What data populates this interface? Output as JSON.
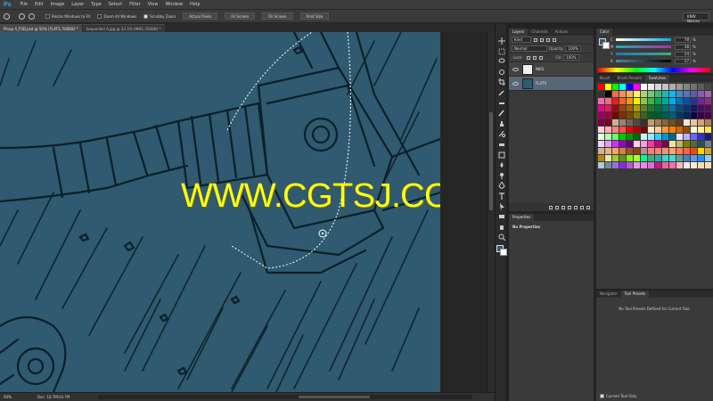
{
  "app": {
    "logo": "Ps"
  },
  "menu": [
    "File",
    "Edit",
    "Image",
    "Layer",
    "Type",
    "Select",
    "Filter",
    "View",
    "Window",
    "Help"
  ],
  "options": {
    "resize_windows": "Resize Windows to Fit",
    "zoom_all_windows": "Zoom All Windows",
    "scrubby_zoom": "Scrubby Zoom",
    "actual_pixels": "Actual Pixels",
    "fit_screen": "Fit Screen",
    "fill_screen": "Fill Screen",
    "print_size": "Print Size",
    "workspace": "KNW Nasrav"
  },
  "tabs": [
    {
      "label": "Pinup A_FSD.psd @ 50% (FLATS, RGB/8) *",
      "active": true
    },
    {
      "label": "Sequential A.jpg @ 33.3% (INKS, RGB/8) *",
      "active": false
    }
  ],
  "canvas": {
    "watermark": "WWW.CGTSJ.COM",
    "fill_color": "#2f5a70",
    "ink_color": "#0d1f2a"
  },
  "status": {
    "zoom": "50%",
    "doc": "Doc: 10.7M/10.7M"
  },
  "layers": {
    "tabs": [
      "Layers",
      "Channels",
      "Actions"
    ],
    "kind": "Kind",
    "blend_mode": "Normal",
    "opacity_label": "Opacity:",
    "opacity": "100%",
    "lock_label": "Lock:",
    "fill_label": "Fill:",
    "fill": "100%",
    "items": [
      {
        "name": "INKS",
        "selected": false
      },
      {
        "name": "FLATS",
        "selected": true
      }
    ]
  },
  "properties": {
    "tab": "Properties",
    "message": "No Properties"
  },
  "color": {
    "tab": "Color",
    "sliders": [
      {
        "label": "C",
        "value": "78",
        "unit": "%"
      },
      {
        "label": "M",
        "value": "38",
        "unit": "%"
      },
      {
        "label": "Y",
        "value": "24",
        "unit": "%"
      },
      {
        "label": "K",
        "value": "27",
        "unit": "%"
      }
    ],
    "foreground": "#2f5a70",
    "background": "#ffffff"
  },
  "swatches_panel": {
    "tabs": [
      "Brush",
      "Brush Presets",
      "Swatches"
    ],
    "colors": [
      "#ff0000",
      "#ffff00",
      "#00ff00",
      "#00ffff",
      "#0000ff",
      "#ff00ff",
      "#ffffff",
      "#ebebeb",
      "#d6d6d6",
      "#c2c2c2",
      "#adadad",
      "#999999",
      "#858585",
      "#707070",
      "#5c5c5c",
      "#474747",
      "#333333",
      "#000000",
      "#f26c4f",
      "#f68e55",
      "#fbaf5c",
      "#fff467",
      "#acd372",
      "#7cc576",
      "#3bb878",
      "#1abbb4",
      "#00bff3",
      "#438ccb",
      "#5574b9",
      "#605ca8",
      "#855fa8",
      "#a763a8",
      "#f06ea9",
      "#f26d7d",
      "#ed1c24",
      "#f26522",
      "#f7941d",
      "#fff200",
      "#8dc63f",
      "#39b54a",
      "#00a651",
      "#00a99d",
      "#00aeef",
      "#0072bc",
      "#0054a6",
      "#2e3192",
      "#662d91",
      "#92278f",
      "#ec008c",
      "#ed145b",
      "#9e0b0f",
      "#a0410d",
      "#a36209",
      "#aba000",
      "#598527",
      "#1a7b30",
      "#007236",
      "#00746b",
      "#0076a3",
      "#004b80",
      "#003471",
      "#1b1464",
      "#440e62",
      "#630460",
      "#9e005d",
      "#9e0039",
      "#790000",
      "#7b2e00",
      "#7d4900",
      "#827b00",
      "#406618",
      "#005e20",
      "#005826",
      "#005952",
      "#005b7f",
      "#003663",
      "#002157",
      "#0d004c",
      "#32004b",
      "#4b0049",
      "#7b0046",
      "#7a0026",
      "#c7b299",
      "#998675",
      "#736357",
      "#534741",
      "#37302d",
      "#c69c6d",
      "#a67c52",
      "#8c6239",
      "#754c24",
      "#603913",
      "#fbe6d1",
      "#e9c4a3",
      "#d4a276",
      "#b87c50",
      "#ffd8d8",
      "#ffb3b3",
      "#ff8080",
      "#ff4d4d",
      "#e60000",
      "#b30000",
      "#800000",
      "#ffe6cc",
      "#ffcc99",
      "#ff9933",
      "#ff8000",
      "#cc6600",
      "#994c00",
      "#fff9cc",
      "#fff099",
      "#ffe44d",
      "#e6ffe6",
      "#b3ffb3",
      "#66ff66",
      "#00cc00",
      "#009900",
      "#006600",
      "#ccf2ff",
      "#99e6ff",
      "#33ccff",
      "#0099cc",
      "#006699",
      "#e6e6ff",
      "#b3b3ff",
      "#6666ff",
      "#3333cc",
      "#1a1a80",
      "#f5d0ff",
      "#e699ff",
      "#cc33ff",
      "#9900cc",
      "#660080",
      "#ffccec",
      "#ff99d9",
      "#ff33b3",
      "#cc0080",
      "#80004d",
      "#f0e68c",
      "#bdb76b",
      "#808000",
      "#556b2f",
      "#2f4f4f",
      "#708090",
      "#d2b48c",
      "#deb887",
      "#f4a460",
      "#cd853f",
      "#a0522d",
      "#8b4513",
      "#bc8f8f",
      "#f08080",
      "#fa8072",
      "#e9967a",
      "#ffa07a",
      "#ff7f50",
      "#ff6347",
      "#ff4500",
      "#ffd700",
      "#daa520",
      "#b8860b",
      "#eee8aa",
      "#9acd32",
      "#6b8e23",
      "#7fff00",
      "#adff2f",
      "#00fa9a",
      "#3cb371",
      "#20b2aa",
      "#48d1cc",
      "#40e0d0",
      "#5f9ea0",
      "#4682b4",
      "#6495ed",
      "#1e90ff",
      "#87cefa",
      "#b0c4de",
      "#778899",
      "#9370db",
      "#8a2be2",
      "#ba55d3",
      "#dda0dd",
      "#ee82ee",
      "#da70d6",
      "#c71585",
      "#db7093",
      "#ff69b4",
      "#ffb6c1",
      "#ffe4e1",
      "#faebd7",
      "#f5deb3",
      "#ffdead"
    ]
  },
  "navigator": {
    "tabs": [
      "Navigator",
      "Tool Presets"
    ],
    "message": "No Tool Presets Defined for Current Tool.",
    "current_tool_only": "Current Tool Only"
  },
  "toolbar": {
    "tools": [
      "move-icon",
      "marquee-icon",
      "lasso-icon",
      "quick-select-icon",
      "crop-icon",
      "eyedropper-icon",
      "healing-icon",
      "brush-icon",
      "clone-stamp-icon",
      "history-brush-icon",
      "eraser-icon",
      "gradient-icon",
      "blur-icon",
      "dodge-icon",
      "pen-icon",
      "type-icon",
      "path-select-icon",
      "rectangle-icon",
      "hand-icon",
      "zoom-icon"
    ]
  }
}
